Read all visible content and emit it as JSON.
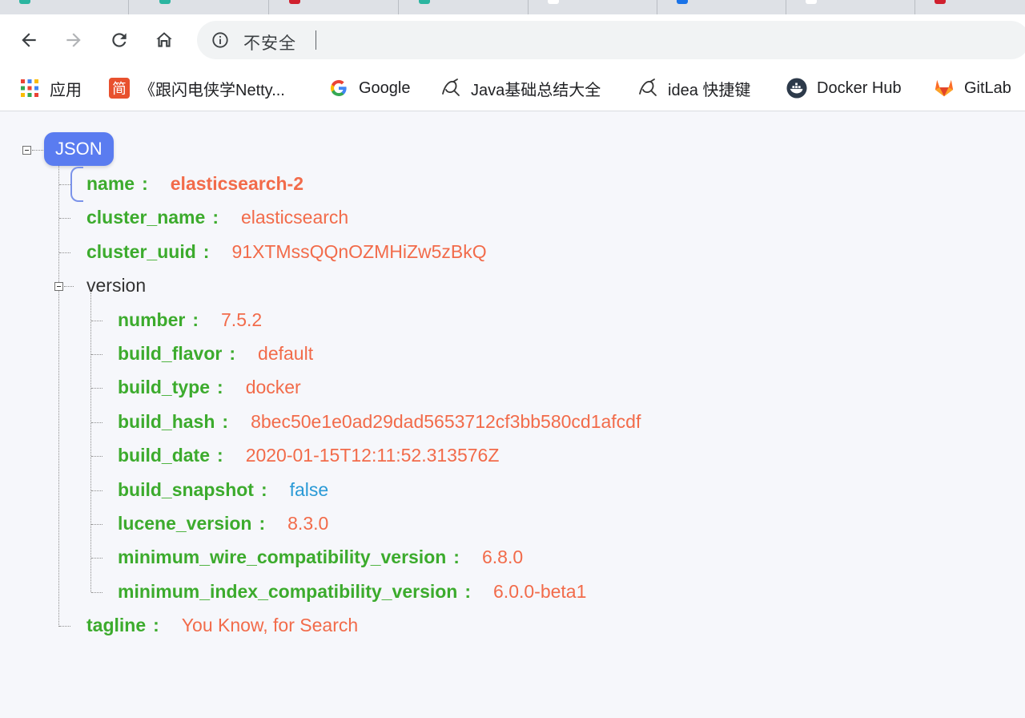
{
  "colors": {
    "accent": "#5a7cf0",
    "key": "#3cab2d",
    "string_value": "#f26b4a",
    "boolean_value": "#2a9ad6"
  },
  "toolbar": {
    "security_label": "不安全"
  },
  "bookmarks": [
    {
      "label": "应用",
      "icon": "apps-grid-icon"
    },
    {
      "label": "《跟闪电侠学Netty...",
      "icon": "jian-icon"
    },
    {
      "label": "Google",
      "icon": "google-icon"
    },
    {
      "label": "Java基础总结大全",
      "icon": "yuque-icon"
    },
    {
      "label": "idea 快捷键",
      "icon": "yuque-icon"
    },
    {
      "label": "Docker Hub",
      "icon": "docker-icon"
    },
    {
      "label": "GitLab",
      "icon": "gitlab-icon"
    }
  ],
  "json": {
    "root_label": "JSON",
    "name": {
      "key": "name",
      "value": "elasticsearch-2"
    },
    "cluster_name": {
      "key": "cluster_name",
      "value": "elasticsearch"
    },
    "cluster_uuid": {
      "key": "cluster_uuid",
      "value": "91XTMssQQnOZMHiZw5zBkQ"
    },
    "version": {
      "key": "version",
      "number": {
        "key": "number",
        "value": "7.5.2"
      },
      "build_flavor": {
        "key": "build_flavor",
        "value": "default"
      },
      "build_type": {
        "key": "build_type",
        "value": "docker"
      },
      "build_hash": {
        "key": "build_hash",
        "value": "8bec50e1e0ad29dad5653712cf3bb580cd1afcdf"
      },
      "build_date": {
        "key": "build_date",
        "value": "2020-01-15T12:11:52.313576Z"
      },
      "build_snapshot": {
        "key": "build_snapshot",
        "value": "false"
      },
      "lucene_version": {
        "key": "lucene_version",
        "value": "8.3.0"
      },
      "minimum_wire_compatibility_version": {
        "key": "minimum_wire_compatibility_version",
        "value": "6.8.0"
      },
      "minimum_index_compatibility_version": {
        "key": "minimum_index_compatibility_version",
        "value": "6.0.0-beta1"
      }
    },
    "tagline": {
      "key": "tagline",
      "value": "You Know, for Search"
    },
    "colon": ":"
  }
}
